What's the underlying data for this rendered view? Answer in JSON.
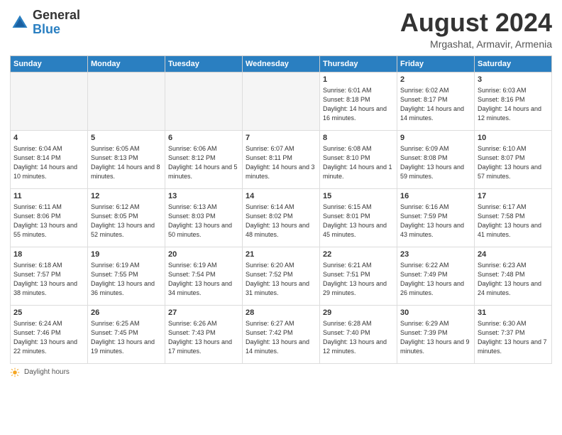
{
  "logo": {
    "text_general": "General",
    "text_blue": "Blue"
  },
  "header": {
    "month_year": "August 2024",
    "location": "Mrgashat, Armavir, Armenia"
  },
  "days_of_week": [
    "Sunday",
    "Monday",
    "Tuesday",
    "Wednesday",
    "Thursday",
    "Friday",
    "Saturday"
  ],
  "footer": {
    "label": "Daylight hours"
  },
  "weeks": [
    {
      "days": [
        {
          "num": "",
          "detail": "",
          "empty": true
        },
        {
          "num": "",
          "detail": "",
          "empty": true
        },
        {
          "num": "",
          "detail": "",
          "empty": true
        },
        {
          "num": "",
          "detail": "",
          "empty": true
        },
        {
          "num": "1",
          "detail": "Sunrise: 6:01 AM\nSunset: 8:18 PM\nDaylight: 14 hours\nand 16 minutes."
        },
        {
          "num": "2",
          "detail": "Sunrise: 6:02 AM\nSunset: 8:17 PM\nDaylight: 14 hours\nand 14 minutes."
        },
        {
          "num": "3",
          "detail": "Sunrise: 6:03 AM\nSunset: 8:16 PM\nDaylight: 14 hours\nand 12 minutes."
        }
      ]
    },
    {
      "days": [
        {
          "num": "4",
          "detail": "Sunrise: 6:04 AM\nSunset: 8:14 PM\nDaylight: 14 hours\nand 10 minutes."
        },
        {
          "num": "5",
          "detail": "Sunrise: 6:05 AM\nSunset: 8:13 PM\nDaylight: 14 hours\nand 8 minutes."
        },
        {
          "num": "6",
          "detail": "Sunrise: 6:06 AM\nSunset: 8:12 PM\nDaylight: 14 hours\nand 5 minutes."
        },
        {
          "num": "7",
          "detail": "Sunrise: 6:07 AM\nSunset: 8:11 PM\nDaylight: 14 hours\nand 3 minutes."
        },
        {
          "num": "8",
          "detail": "Sunrise: 6:08 AM\nSunset: 8:10 PM\nDaylight: 14 hours\nand 1 minute."
        },
        {
          "num": "9",
          "detail": "Sunrise: 6:09 AM\nSunset: 8:08 PM\nDaylight: 13 hours\nand 59 minutes."
        },
        {
          "num": "10",
          "detail": "Sunrise: 6:10 AM\nSunset: 8:07 PM\nDaylight: 13 hours\nand 57 minutes."
        }
      ]
    },
    {
      "days": [
        {
          "num": "11",
          "detail": "Sunrise: 6:11 AM\nSunset: 8:06 PM\nDaylight: 13 hours\nand 55 minutes."
        },
        {
          "num": "12",
          "detail": "Sunrise: 6:12 AM\nSunset: 8:05 PM\nDaylight: 13 hours\nand 52 minutes."
        },
        {
          "num": "13",
          "detail": "Sunrise: 6:13 AM\nSunset: 8:03 PM\nDaylight: 13 hours\nand 50 minutes."
        },
        {
          "num": "14",
          "detail": "Sunrise: 6:14 AM\nSunset: 8:02 PM\nDaylight: 13 hours\nand 48 minutes."
        },
        {
          "num": "15",
          "detail": "Sunrise: 6:15 AM\nSunset: 8:01 PM\nDaylight: 13 hours\nand 45 minutes."
        },
        {
          "num": "16",
          "detail": "Sunrise: 6:16 AM\nSunset: 7:59 PM\nDaylight: 13 hours\nand 43 minutes."
        },
        {
          "num": "17",
          "detail": "Sunrise: 6:17 AM\nSunset: 7:58 PM\nDaylight: 13 hours\nand 41 minutes."
        }
      ]
    },
    {
      "days": [
        {
          "num": "18",
          "detail": "Sunrise: 6:18 AM\nSunset: 7:57 PM\nDaylight: 13 hours\nand 38 minutes."
        },
        {
          "num": "19",
          "detail": "Sunrise: 6:19 AM\nSunset: 7:55 PM\nDaylight: 13 hours\nand 36 minutes."
        },
        {
          "num": "20",
          "detail": "Sunrise: 6:19 AM\nSunset: 7:54 PM\nDaylight: 13 hours\nand 34 minutes."
        },
        {
          "num": "21",
          "detail": "Sunrise: 6:20 AM\nSunset: 7:52 PM\nDaylight: 13 hours\nand 31 minutes."
        },
        {
          "num": "22",
          "detail": "Sunrise: 6:21 AM\nSunset: 7:51 PM\nDaylight: 13 hours\nand 29 minutes."
        },
        {
          "num": "23",
          "detail": "Sunrise: 6:22 AM\nSunset: 7:49 PM\nDaylight: 13 hours\nand 26 minutes."
        },
        {
          "num": "24",
          "detail": "Sunrise: 6:23 AM\nSunset: 7:48 PM\nDaylight: 13 hours\nand 24 minutes."
        }
      ]
    },
    {
      "days": [
        {
          "num": "25",
          "detail": "Sunrise: 6:24 AM\nSunset: 7:46 PM\nDaylight: 13 hours\nand 22 minutes."
        },
        {
          "num": "26",
          "detail": "Sunrise: 6:25 AM\nSunset: 7:45 PM\nDaylight: 13 hours\nand 19 minutes."
        },
        {
          "num": "27",
          "detail": "Sunrise: 6:26 AM\nSunset: 7:43 PM\nDaylight: 13 hours\nand 17 minutes."
        },
        {
          "num": "28",
          "detail": "Sunrise: 6:27 AM\nSunset: 7:42 PM\nDaylight: 13 hours\nand 14 minutes."
        },
        {
          "num": "29",
          "detail": "Sunrise: 6:28 AM\nSunset: 7:40 PM\nDaylight: 13 hours\nand 12 minutes."
        },
        {
          "num": "30",
          "detail": "Sunrise: 6:29 AM\nSunset: 7:39 PM\nDaylight: 13 hours\nand 9 minutes."
        },
        {
          "num": "31",
          "detail": "Sunrise: 6:30 AM\nSunset: 7:37 PM\nDaylight: 13 hours\nand 7 minutes."
        }
      ]
    }
  ]
}
